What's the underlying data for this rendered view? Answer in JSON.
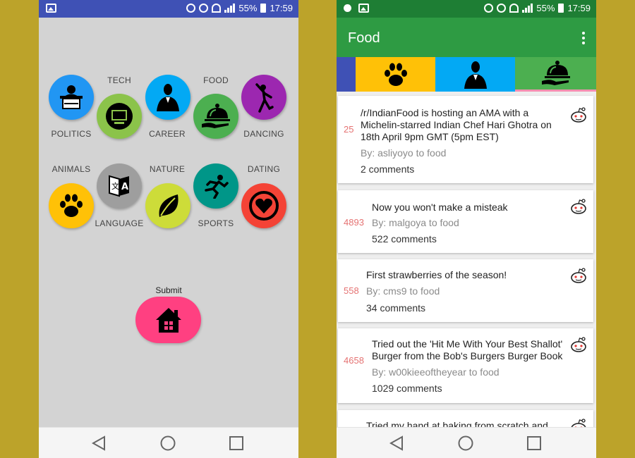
{
  "left_screen": {
    "status": {
      "battery": "55%",
      "time": "17:59",
      "network": "4G"
    },
    "categories": [
      {
        "id": "politics",
        "label": "POLITICS",
        "color": "#2196f3",
        "icon": "podium-icon"
      },
      {
        "id": "tech",
        "label": "TECH",
        "color": "#8bc34a",
        "icon": "monitor-icon"
      },
      {
        "id": "career",
        "label": "CAREER",
        "color": "#03a9f4",
        "icon": "businessman-icon"
      },
      {
        "id": "food",
        "label": "FOOD",
        "color": "#4caf50",
        "icon": "cloche-icon"
      },
      {
        "id": "dancing",
        "label": "DANCING",
        "color": "#9c27b0",
        "icon": "dancer-icon"
      },
      {
        "id": "animals",
        "label": "ANIMALS",
        "color": "#ffc107",
        "icon": "paw-icon"
      },
      {
        "id": "language",
        "label": "LANGUAGE",
        "color": "#9e9e9e",
        "icon": "translate-icon"
      },
      {
        "id": "nature",
        "label": "NATURE",
        "color": "#cddc39",
        "icon": "leaf-icon"
      },
      {
        "id": "sports",
        "label": "SPORTS",
        "color": "#009688",
        "icon": "runner-icon"
      },
      {
        "id": "dating",
        "label": "DATING",
        "color": "#f44336",
        "icon": "heart-icon"
      }
    ],
    "submit": {
      "label": "Submit",
      "icon": "home-icon",
      "color": "#ff4081"
    }
  },
  "right_screen": {
    "status": {
      "battery": "55%",
      "time": "17:59",
      "network": "4G"
    },
    "app_title": "Food",
    "tabs": [
      {
        "icon": "paw-icon",
        "color": "#ffc107"
      },
      {
        "icon": "businessman-icon",
        "color": "#03a9f4"
      },
      {
        "icon": "cloche-icon",
        "color": "#4caf50",
        "selected": true
      }
    ],
    "posts": [
      {
        "score": "25",
        "title": "/r/IndianFood is hosting an AMA with a Michelin-starred Indian Chef Hari Ghotra on 18th April 9pm GMT (5pm EST)",
        "by": "By: asliyoyo to food",
        "comments": "2 comments"
      },
      {
        "score": "4893",
        "title": "Now you won't make a misteak",
        "by": "By: malgoya to food",
        "comments": "522 comments"
      },
      {
        "score": "558",
        "title": "First strawberries of the season!",
        "by": "By: cms9 to food",
        "comments": "34 comments"
      },
      {
        "score": "4658",
        "title": "Tried out the 'Hit Me With Your Best Shallot' Burger from the Bob's Burgers Burger Book",
        "by": "By: w00kieeoftheyear to food",
        "comments": "1029 comments"
      },
      {
        "score": "",
        "title": "Tried my hand at baking from scratch and",
        "by": "",
        "comments": ""
      }
    ]
  }
}
